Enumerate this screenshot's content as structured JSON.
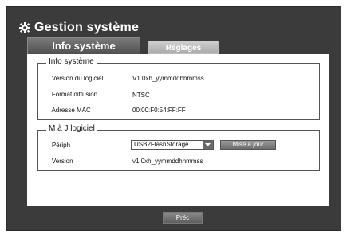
{
  "window": {
    "title": "Gestion système",
    "title_icon": "gear-icon"
  },
  "tabs": [
    {
      "label": "Info système",
      "active": true
    },
    {
      "label": "Réglages",
      "active": false
    }
  ],
  "info_system": {
    "legend": "Info système",
    "rows": [
      {
        "label": "· Version du logiciel",
        "value": "V1.0xh_yymmddhhmmss"
      },
      {
        "label": "· Format diffusion",
        "value": "NTSC"
      },
      {
        "label": "· Adresse MAC",
        "value": "00:00:F0:54:FF:FF"
      }
    ]
  },
  "software_update": {
    "legend": "M à J logiciel",
    "device_label": "· Périph",
    "device_selected": "USB2FlashStorage",
    "update_button": "Mise à jour",
    "version_label": "· Version",
    "version_value": "v1.0xh_yymmddhhmmss"
  },
  "footer": {
    "prev_button": "Préc"
  },
  "colors": {
    "frame": "#3b3b3b",
    "content": "#ffffff",
    "button": "#7a7a7a",
    "text": "#111111"
  }
}
